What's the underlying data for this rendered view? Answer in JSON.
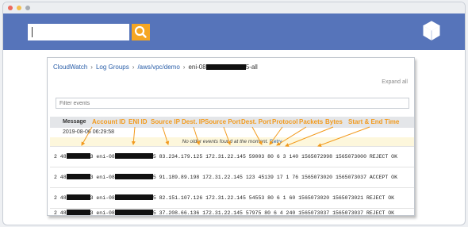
{
  "search": {
    "placeholder": ""
  },
  "breadcrumb": {
    "cloudwatch": "CloudWatch",
    "log_groups": "Log Groups",
    "log_group": "/aws/vpc/demo",
    "stream_prefix": "eni-08",
    "stream_suffix": "5-all"
  },
  "expand_all": "Expand all",
  "filter": {
    "placeholder": "Filter events"
  },
  "message_header": "Message",
  "date_row": "2019-08-06 06:29:58",
  "no_older": {
    "text": "No older events found at the moment.",
    "retry": "Retry"
  },
  "rows": [
    {
      "prefix": "2 48",
      "mid1": "3 eni-08",
      "rest": "5 83.234.179.125 172.31.22.145 59003 80 6 3 140 1565072998 1565073000 REJECT OK"
    },
    {
      "prefix": "2 48",
      "mid1": "3 eni-08",
      "rest": "5 91.189.89.198 172.31.22.145 123 45139 17 1 76 1565073020 1565073037 ACCEPT OK"
    },
    {
      "prefix": "2 48",
      "mid1": "3 eni-08",
      "rest": "5 82.151.107.126 172.31.22.145 54553 80 6 1 60 1565073020 1565073021 REJECT OK"
    },
    {
      "prefix": "2 48",
      "mid1": "3 eni-08",
      "rest": "5 37.208.66.136 172.31.22.145 57975 80 6 4 240 1565073037 1565073037 REJECT OK"
    }
  ],
  "annotations": {
    "account_id": "Account ID",
    "eni_id": "ENI ID",
    "source_ip": "Source IP",
    "dest_ip": "Dest. IP",
    "source_port": "Source Port",
    "dest_port": "Dest. Port",
    "protocol": "Protocol",
    "packets": "Packets",
    "bytes": "Bytes",
    "start_end_time": "Start & End Time"
  },
  "colors": {
    "nav": "#5674ba",
    "search_button": "#f5a623",
    "annotation": "#f29a1d"
  },
  "icons": {
    "search": "search-icon",
    "logo": "cube-icon"
  }
}
